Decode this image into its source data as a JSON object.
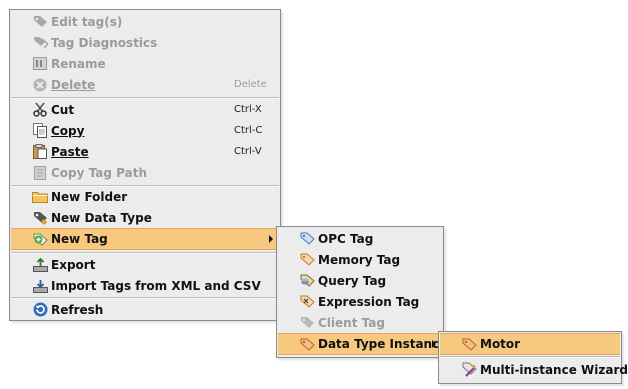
{
  "menu": {
    "items": [
      {
        "label": "Edit tag(s)",
        "icon": "tag-icon",
        "disabled": true
      },
      {
        "label": "Tag Diagnostics",
        "icon": "tags-icon",
        "disabled": true
      },
      {
        "label": "Rename",
        "icon": "rename-icon",
        "disabled": true
      },
      {
        "label": "Delete",
        "icon": "delete-icon",
        "shortcut": "Delete",
        "disabled": true
      },
      {
        "label": "Cut",
        "icon": "scissors-icon",
        "shortcut": "Ctrl-X"
      },
      {
        "label": "Copy",
        "icon": "copy-icon",
        "shortcut": "Ctrl-C"
      },
      {
        "label": "Paste",
        "icon": "clipboard-icon",
        "shortcut": "Ctrl-V"
      },
      {
        "label": "Copy Tag Path",
        "icon": "document-icon",
        "disabled": true
      },
      {
        "label": "New Folder",
        "icon": "folder-icon"
      },
      {
        "label": "New Data Type",
        "icon": "data-type-icon"
      },
      {
        "label": "New Tag",
        "icon": "new-tag-icon",
        "highlighted": true
      },
      {
        "label": "Export",
        "icon": "export-icon"
      },
      {
        "label": "Import Tags from XML and CSV",
        "icon": "import-icon"
      },
      {
        "label": "Refresh",
        "icon": "refresh-icon"
      }
    ]
  },
  "new_tag_submenu": {
    "items": [
      {
        "label": "OPC Tag",
        "icon": "opc-tag-icon"
      },
      {
        "label": "Memory Tag",
        "icon": "memory-tag-icon"
      },
      {
        "label": "Query Tag",
        "icon": "query-tag-icon"
      },
      {
        "label": "Expression Tag",
        "icon": "expression-tag-icon"
      },
      {
        "label": "Client Tag",
        "icon": "client-tag-icon",
        "disabled": true
      },
      {
        "label": "Data Type Instance",
        "icon": "data-type-instance-icon",
        "highlighted": true
      }
    ]
  },
  "data_type_instance_submenu": {
    "items": [
      {
        "label": "Motor",
        "icon": "tag-icon",
        "highlighted": true
      },
      {
        "label": "Multi-instance Wizard",
        "icon": "wizard-icon"
      }
    ]
  },
  "colors": {
    "menu_bg": "#ececec",
    "highlight": "#f6c880",
    "disabled_text": "#9b9b9b"
  }
}
